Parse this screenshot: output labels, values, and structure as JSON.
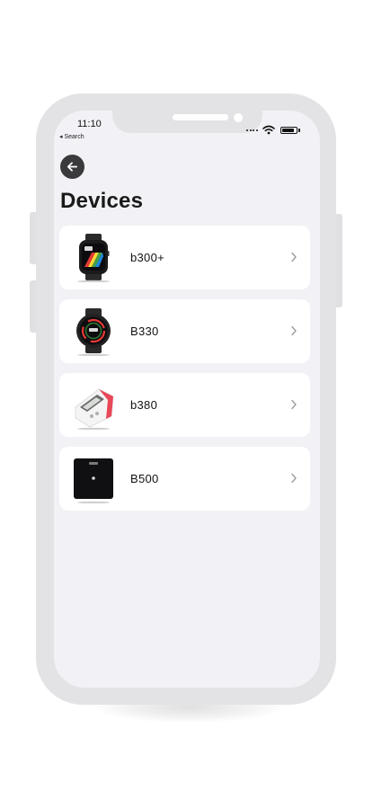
{
  "status_bar": {
    "time": "11:10",
    "back_app": "◂ Search"
  },
  "header": {
    "title": "Devices"
  },
  "devices": [
    {
      "name": "b300+",
      "icon": "smartwatch-square-icon"
    },
    {
      "name": "B330",
      "icon": "smartwatch-round-icon"
    },
    {
      "name": "b380",
      "icon": "blood-pressure-monitor-icon"
    },
    {
      "name": "B500",
      "icon": "smart-scale-icon"
    }
  ],
  "colors": {
    "background": "#f2f2f6",
    "card": "#ffffff",
    "back_button": "#3a3a3c",
    "chevron": "#b0b0b5"
  }
}
